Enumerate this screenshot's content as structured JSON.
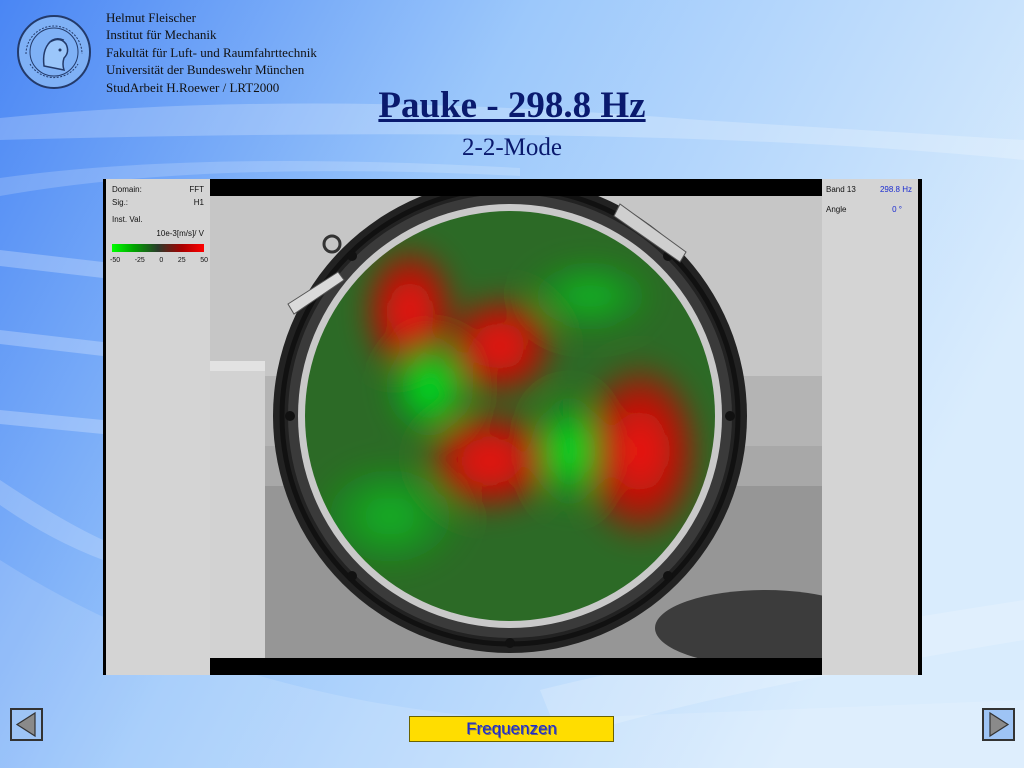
{
  "header": {
    "affiliation": [
      "Helmut Fleischer",
      "Institut für Mechanik",
      "Fakultät für Luft- und Raumfahrttechnik",
      "Universität der Bundeswehr München",
      "StudArbeit H.Roewer / LRT2000"
    ],
    "logo_icon": "university-seal-icon",
    "logo_text": "UNIVERSITÄT DER BUNDESWEHR MÜNCHEN"
  },
  "title": "Pauke - 298.8 Hz",
  "subtitle": "2-2-Mode",
  "screenshot": {
    "left_panel": {
      "domain_label": "Domain:",
      "domain_value": "FFT",
      "sig_label": "Sig.:",
      "sig_value": "H1",
      "inst_label": "Inst. Val.",
      "unit": "10e-3[m/s]/ V",
      "scale_ticks": [
        "-50",
        "-25",
        "0",
        "25",
        "50"
      ]
    },
    "right_panel": {
      "band_label": "Band 13",
      "band_value": "298.8 Hz",
      "angle_label": "Angle",
      "angle_value": "0 °"
    },
    "colors": {
      "positive": "#ff0000",
      "negative": "#00ff00"
    }
  },
  "nav": {
    "prev_icon": "triangle-left-icon",
    "next_icon": "triangle-right-icon",
    "frequenzen_label": "Frequenzen"
  }
}
